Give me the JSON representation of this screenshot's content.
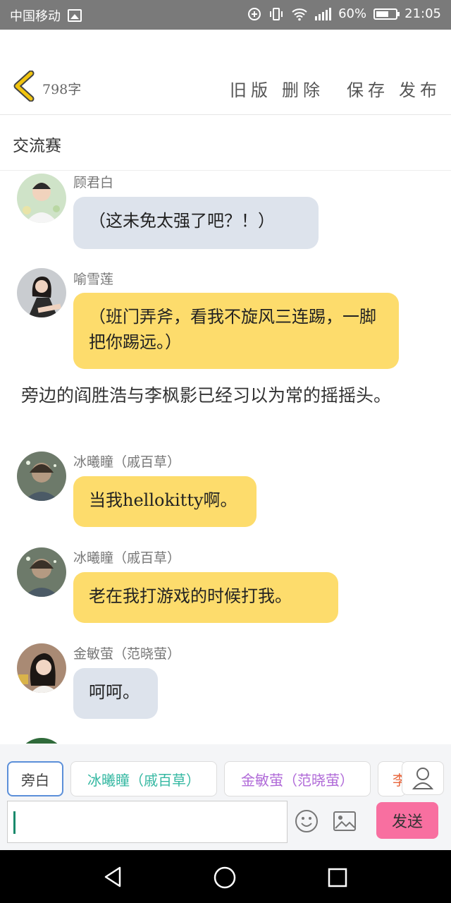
{
  "status_bar": {
    "carrier": "中国移动",
    "battery": "60%",
    "time": "21:05"
  },
  "toolbar": {
    "word_count": "798字",
    "actions": [
      "旧版",
      "删除",
      "保存",
      "发布"
    ]
  },
  "chapter_title": "交流赛",
  "messages": [
    {
      "sender": "顾君白",
      "text": "（这未免太强了吧？！）",
      "style": "gray"
    },
    {
      "sender": "喻雪莲",
      "text": "（班门弄斧，看我不旋风三连踢，一脚把你踢远。）",
      "style": "yellow"
    },
    {
      "sender": "冰曦瞳（戚百草）",
      "text": "当我hellokitty啊。",
      "style": "yellow"
    },
    {
      "sender": "冰曦瞳（戚百草）",
      "text": "老在我打游戏的时候打我。",
      "style": "yellow"
    },
    {
      "sender": "金敏萤（范晓萤）",
      "text": "呵呵。",
      "style": "gray"
    }
  ],
  "narration": "旁边的阎胜浩与李枫影已经习以为常的摇摇头。",
  "role_chips": [
    {
      "label": "旁白",
      "color": "#444444"
    },
    {
      "label": "冰曦瞳（戚百草）",
      "color": "#35b8a2"
    },
    {
      "label": "金敏萤（范晓萤）",
      "color": "#b06ad8"
    },
    {
      "label": "李",
      "color": "#e8643a"
    }
  ],
  "composer": {
    "send_label": "发送"
  },
  "colors": {
    "accent_yellow": "#fddc6c",
    "bubble_gray": "#dde3ec",
    "send_pink": "#f86fa0",
    "back_yellow": "#f1c40f"
  },
  "icons": [
    "back-chevron-icon",
    "emoji-icon",
    "image-icon",
    "profile-icon",
    "nav-back-icon",
    "nav-home-icon",
    "nav-recents-icon"
  ]
}
